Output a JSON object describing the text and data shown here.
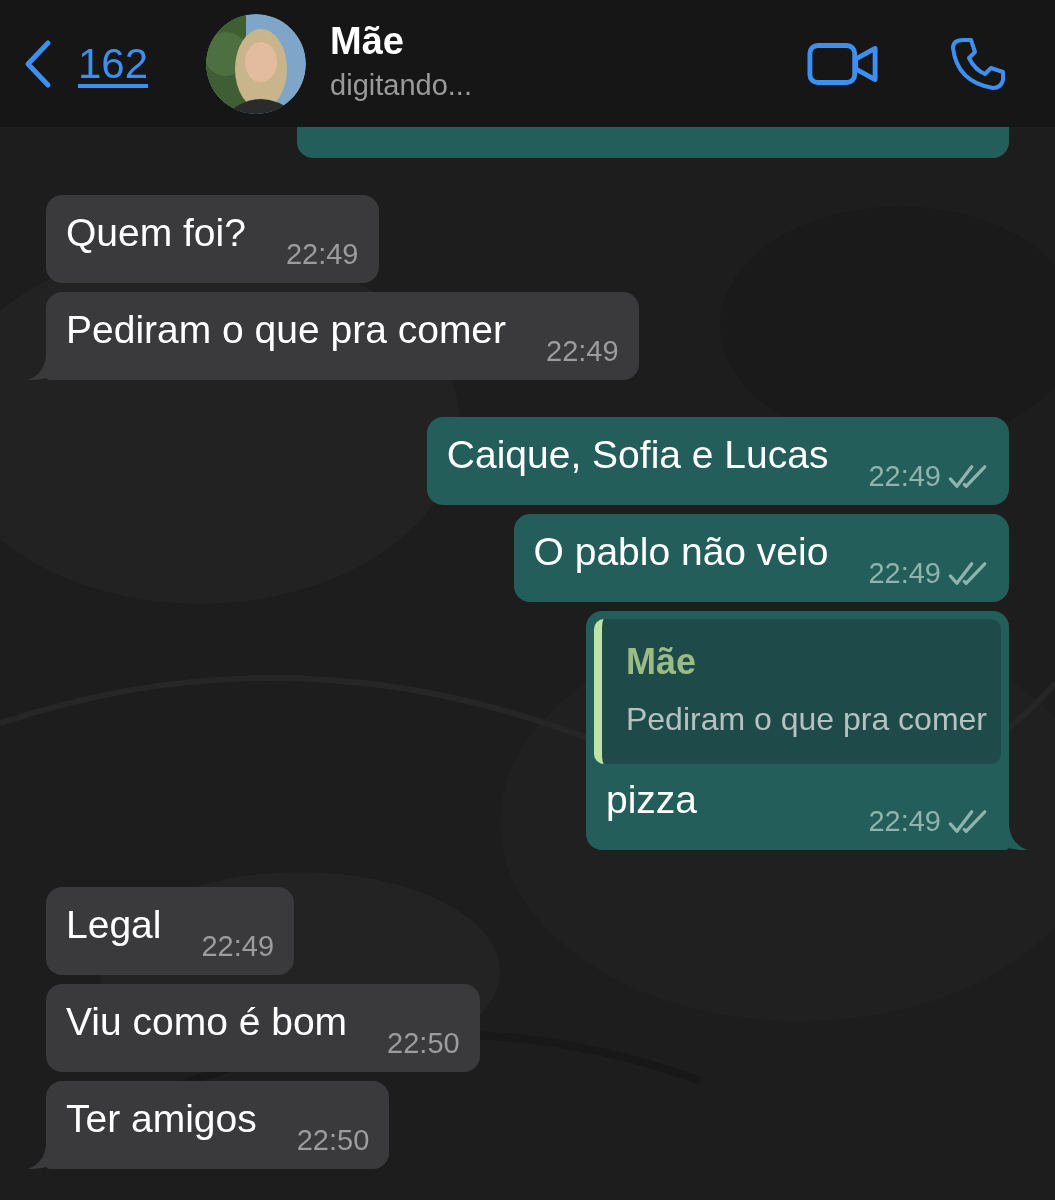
{
  "header": {
    "back_count": "162",
    "contact_name": "Mãe",
    "status": "digitando..."
  },
  "messages": [
    {
      "kind": "incoming",
      "text": "Quem foi?",
      "time": "22:49",
      "tail": false
    },
    {
      "kind": "incoming",
      "text": "Pediram o que pra comer",
      "time": "22:49",
      "tail": true
    },
    {
      "kind": "outgoing",
      "text": "Caique, Sofia e Lucas",
      "time": "22:49",
      "tail": false
    },
    {
      "kind": "outgoing",
      "text": "O pablo não veio",
      "time": "22:49",
      "tail": false
    },
    {
      "kind": "outgoing",
      "text": "pizza",
      "time": "22:49",
      "tail": true,
      "reply": {
        "author": "Mãe",
        "text": "Pediram o que pra comer"
      }
    },
    {
      "kind": "incoming",
      "text": "Legal",
      "time": "22:49",
      "tail": false
    },
    {
      "kind": "incoming",
      "text": "Viu como é bom",
      "time": "22:50",
      "tail": false
    },
    {
      "kind": "incoming",
      "text": "Ter amigos",
      "time": "22:50",
      "tail": true
    }
  ]
}
